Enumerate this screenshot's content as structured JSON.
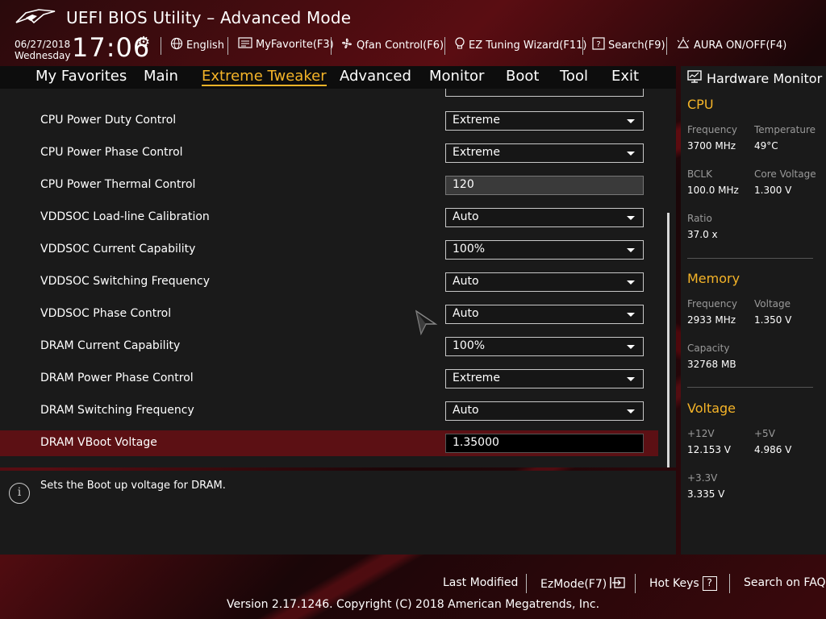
{
  "header": {
    "app_title": "UEFI BIOS Utility – Advanced Mode",
    "date": "06/27/2018",
    "weekday": "Wednesday",
    "time": "17:06",
    "toolbar": [
      {
        "label": "English",
        "icon": "globe-icon"
      },
      {
        "label": "MyFavorite(F3)",
        "icon": "favorite-icon"
      },
      {
        "label": "Qfan Control(F6)",
        "icon": "fan-icon"
      },
      {
        "label": "EZ Tuning Wizard(F11)",
        "icon": "bulb-icon"
      },
      {
        "label": "Search(F9)",
        "icon": "search-icon"
      },
      {
        "label": "AURA ON/OFF(F4)",
        "icon": "aura-icon"
      }
    ]
  },
  "menu": {
    "items": [
      "My Favorites",
      "Main",
      "Extreme Tweaker",
      "Advanced",
      "Monitor",
      "Boot",
      "Tool",
      "Exit"
    ],
    "active": "Extreme Tweaker"
  },
  "settings": [
    {
      "label": "CPU Power Duty Control",
      "value": "Extreme",
      "type": "dropdown"
    },
    {
      "label": "CPU Power Phase Control",
      "value": "Extreme",
      "type": "dropdown"
    },
    {
      "label": "CPU Power Thermal Control",
      "value": "120",
      "type": "readonly"
    },
    {
      "label": "VDDSOC Load-line Calibration",
      "value": "Auto",
      "type": "dropdown"
    },
    {
      "label": "VDDSOC Current Capability",
      "value": "100%",
      "type": "dropdown"
    },
    {
      "label": "VDDSOC Switching Frequency",
      "value": "Auto",
      "type": "dropdown"
    },
    {
      "label": "VDDSOC Phase Control",
      "value": "Auto",
      "type": "dropdown"
    },
    {
      "label": "DRAM Current Capability",
      "value": "100%",
      "type": "dropdown"
    },
    {
      "label": "DRAM Power Phase Control",
      "value": "Extreme",
      "type": "dropdown"
    },
    {
      "label": "DRAM Switching Frequency",
      "value": "Auto",
      "type": "dropdown"
    },
    {
      "label": "DRAM VBoot Voltage",
      "value": "1.35000",
      "type": "input",
      "selected": true
    }
  ],
  "help": {
    "text": "Sets the Boot up voltage for DRAM."
  },
  "hardware_monitor": {
    "title": "Hardware Monitor",
    "cpu": {
      "heading": "CPU",
      "frequency_label": "Frequency",
      "frequency": "3700 MHz",
      "temperature_label": "Temperature",
      "temperature": "49°C",
      "bclk_label": "BCLK",
      "bclk": "100.0 MHz",
      "core_voltage_label": "Core Voltage",
      "core_voltage": "1.300 V",
      "ratio_label": "Ratio",
      "ratio": "37.0 x"
    },
    "memory": {
      "heading": "Memory",
      "frequency_label": "Frequency",
      "frequency": "2933 MHz",
      "voltage_label": "Voltage",
      "voltage": "1.350 V",
      "capacity_label": "Capacity",
      "capacity": "32768 MB"
    },
    "voltage": {
      "heading": "Voltage",
      "v12_label": "+12V",
      "v12": "12.153 V",
      "v5_label": "+5V",
      "v5": "4.986 V",
      "v33_label": "+3.3V",
      "v33": "3.335 V"
    }
  },
  "footer": {
    "last_modified": "Last Modified",
    "ezmode": "EzMode(F7)",
    "hot_keys": "Hot Keys",
    "hot_keys_icon": "?",
    "search_faq": "Search on FAQ",
    "version": "Version 2.17.1246. Copyright (C) 2018 American Megatrends, Inc."
  },
  "colors": {
    "accent": "#f5b428",
    "selected_row": "#5c1014",
    "panel": "#1a1a1a"
  }
}
